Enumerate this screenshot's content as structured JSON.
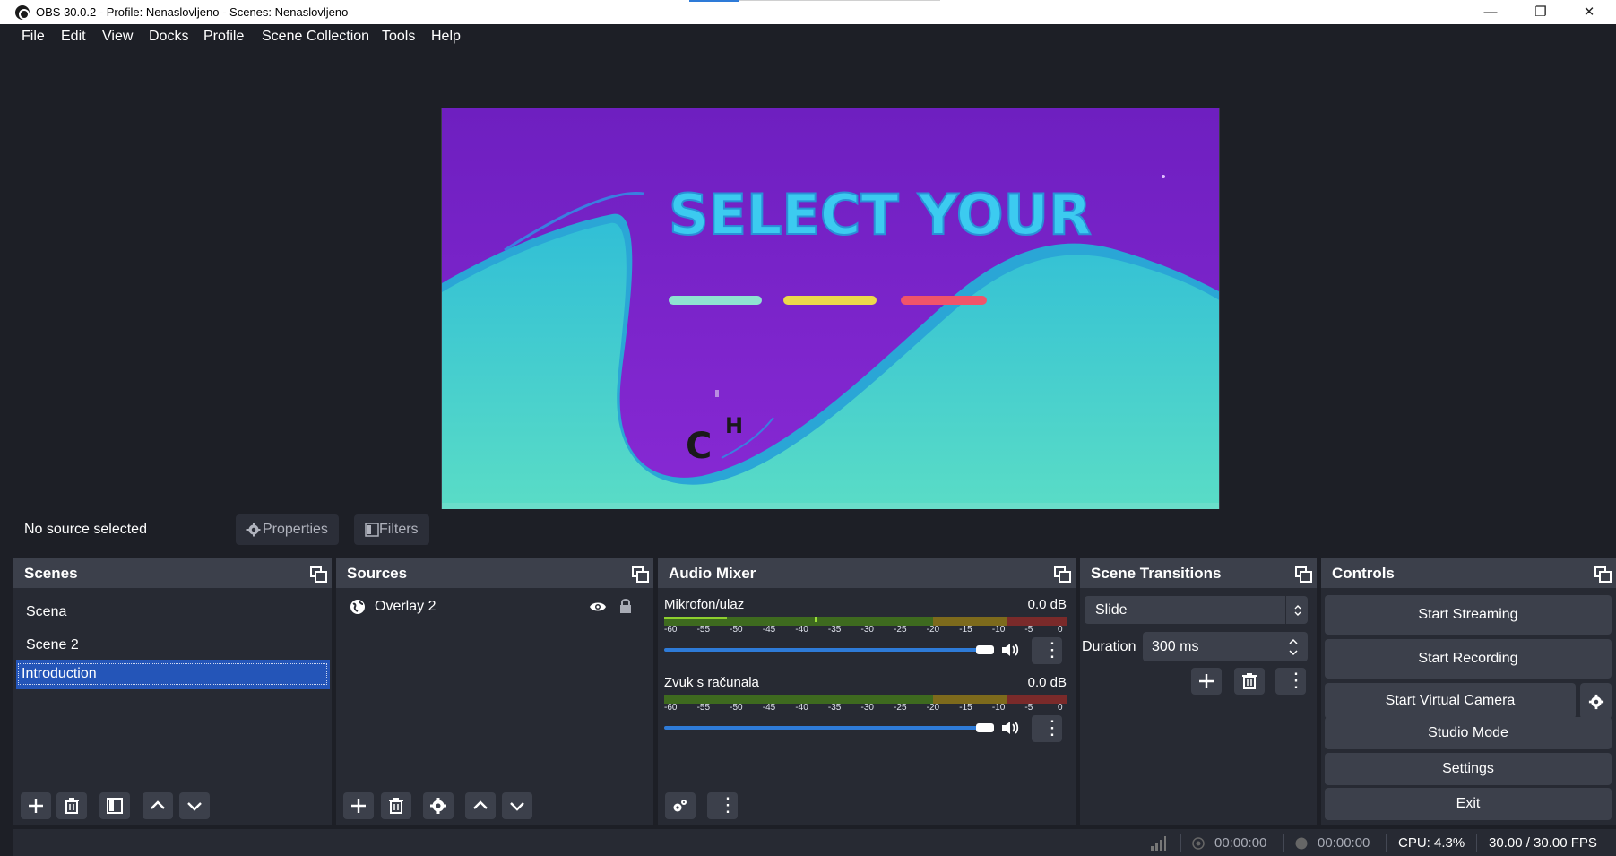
{
  "window": {
    "title": "OBS 30.0.2 - Profile: Nenaslovljeno - Scenes: Nenaslovljeno"
  },
  "menu": [
    "File",
    "Edit",
    "View",
    "Docks",
    "Profile",
    "Scene Collection",
    "Tools",
    "Help"
  ],
  "preview": {
    "heading": "SELECT YOUR",
    "letters": [
      "C",
      "H"
    ]
  },
  "context": {
    "status": "No source selected",
    "properties_label": "Properties",
    "filters_label": "Filters"
  },
  "scenes": {
    "title": "Scenes",
    "items": [
      "Scena",
      "Scene 2",
      "Introduction"
    ],
    "selected": "Introduction"
  },
  "sources": {
    "title": "Sources",
    "items": [
      {
        "name": "Overlay 2",
        "visible": true,
        "locked": true
      }
    ]
  },
  "audio_mixer": {
    "title": "Audio Mixer",
    "ticks": [
      "-60",
      "-55",
      "-50",
      "-45",
      "-40",
      "-35",
      "-30",
      "-25",
      "-20",
      "-15",
      "-10",
      "-5",
      "0"
    ],
    "channels": [
      {
        "name": "Mikrofon/ulaz",
        "level": "0.0 dB",
        "volume": 1.0
      },
      {
        "name": "Zvuk s računala",
        "level": "0.0 dB",
        "volume": 1.0
      }
    ]
  },
  "transitions": {
    "title": "Scene Transitions",
    "selected": "Slide",
    "duration_label": "Duration",
    "duration_value": "300 ms"
  },
  "controls": {
    "title": "Controls",
    "start_streaming": "Start Streaming",
    "start_recording": "Start Recording",
    "start_virtual_camera": "Start Virtual Camera",
    "studio_mode": "Studio Mode",
    "settings": "Settings",
    "exit": "Exit"
  },
  "status": {
    "stream_time": "00:00:00",
    "record_time": "00:00:00",
    "cpu": "CPU: 4.3%",
    "fps": "30.00 / 30.00 FPS"
  },
  "colors": {
    "accent_blue": "#2e7bd8",
    "selection": "#2455b8",
    "dock_bg": "#272a33",
    "dock_header": "#3c404b",
    "preview_purple": "#7a21c8",
    "preview_teal": "#3fd0cf"
  }
}
